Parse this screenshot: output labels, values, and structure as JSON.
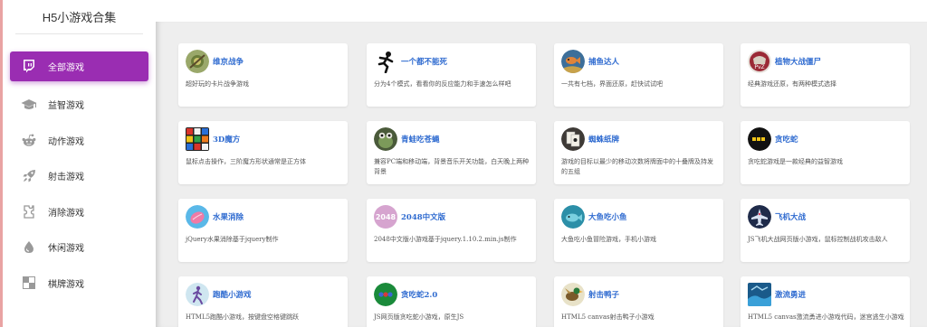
{
  "sidebar": {
    "brand": "H5小游戏合集",
    "items": [
      {
        "label": "全部游戏",
        "icon": "twitch-icon",
        "active": true
      },
      {
        "label": "益智游戏",
        "icon": "graduation-cap-icon"
      },
      {
        "label": "动作游戏",
        "icon": "reddit-icon"
      },
      {
        "label": "射击游戏",
        "icon": "rocket-icon"
      },
      {
        "label": "消除游戏",
        "icon": "puzzle-icon"
      },
      {
        "label": "休闲游戏",
        "icon": "drop-icon"
      },
      {
        "label": "棋牌游戏",
        "icon": "checkerboard-icon"
      }
    ]
  },
  "theme": {
    "accent": "#9a2db2",
    "title_color": "#2f6bd0"
  },
  "games": [
    {
      "title": "维京战争",
      "desc": "超好玩的卡片战争游戏",
      "icon": "viking-war-thumb"
    },
    {
      "title": "一个都不能死",
      "desc": "分为4个模式，看看你的反应能力和手速怎么样吧",
      "icon": "running-man-thumb"
    },
    {
      "title": "捕鱼达人",
      "desc": "一共有七档，界面还原，赶快试试吧",
      "icon": "fishing-thumb"
    },
    {
      "title": "植物大战僵尸",
      "desc": "经典游戏还原，有两种模式选择",
      "icon": "pvz-thumb"
    },
    {
      "title": "3D魔方",
      "desc": "鼠标点击操作，三阶魔方形状通常是正方体",
      "icon": "rubiks-cube-thumb"
    },
    {
      "title": "青蛙吃苍蝇",
      "desc": "兼容PC端和移动端，背景音乐开关功能，白天晚上两种背景",
      "icon": "frog-thumb"
    },
    {
      "title": "蜘蛛纸牌",
      "desc": "游戏的目标以最少的移动次数将牌面中的十叠牌及持发的五组",
      "icon": "spider-solitaire-thumb"
    },
    {
      "title": "贪吃蛇",
      "desc": "贪吃蛇游戏是一款经典的益智游戏",
      "icon": "snake-thumb"
    },
    {
      "title": "水果消除",
      "desc": "jQuery水果消除基于jquery制作",
      "icon": "fruit-thumb"
    },
    {
      "title": "2048中文版",
      "desc": "2048中文版小游戏基于jquery.1.10.2.min.js制作",
      "icon": "2048-thumb",
      "thumb_text": "2048"
    },
    {
      "title": "大鱼吃小鱼",
      "desc": "大鱼吃小鱼冒险游戏，手机小游戏",
      "icon": "big-fish-thumb"
    },
    {
      "title": "飞机大战",
      "desc": "JS飞机大战网页版小游戏，鼠标控制战机攻击敌人",
      "icon": "plane-war-thumb"
    },
    {
      "title": "跑酷小游戏",
      "desc": "HTML5跑酷小游戏，按键盘空格键跳跃",
      "icon": "parkour-thumb"
    },
    {
      "title": "贪吃蛇2.0",
      "desc": "JS网页版贪吃蛇小游戏，原生JS",
      "icon": "snake2-thumb"
    },
    {
      "title": "射击鸭子",
      "desc": "HTML5 canvas射击鸭子小游戏",
      "icon": "duck-hunt-thumb"
    },
    {
      "title": "激流勇进",
      "desc": "HTML5 canvas激流勇进小游戏代码，迷宫逃生小游戏",
      "icon": "rapids-thumb"
    }
  ]
}
